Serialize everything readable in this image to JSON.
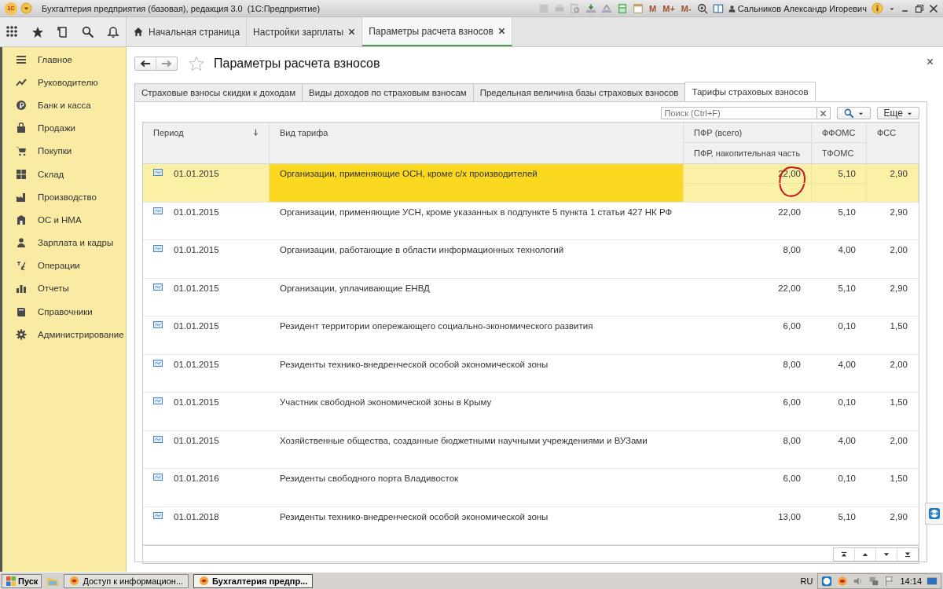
{
  "window": {
    "logo": "1С",
    "title": "Бухгалтерия предприятия (базовая), редакция 3.0  (1С:Предприятие)",
    "memory_buttons": [
      "M",
      "M+",
      "M-"
    ],
    "user": "Сальников Александр Игоревич"
  },
  "section_tabs": [
    {
      "label": "Начальная страница",
      "kind": "home",
      "selected": false
    },
    {
      "label": "Настройки зарплаты",
      "kind": "closable",
      "selected": false
    },
    {
      "label": "Параметры расчета взносов",
      "kind": "closable",
      "selected": true
    }
  ],
  "sidebar": {
    "items": [
      {
        "label": "Главное",
        "kind": "lines"
      },
      {
        "label": "Руководителю",
        "kind": "trend"
      },
      {
        "label": "Банк и касса",
        "kind": "coin"
      },
      {
        "label": "Продажи",
        "kind": "bag"
      },
      {
        "label": "Покупки",
        "kind": "cart"
      },
      {
        "label": "Склад",
        "kind": "grid"
      },
      {
        "label": "Производство",
        "kind": "factory"
      },
      {
        "label": "ОС и НМА",
        "kind": "building"
      },
      {
        "label": "Зарплата и кадры",
        "kind": "person"
      },
      {
        "label": "Операции",
        "kind": "ledger"
      },
      {
        "label": "Отчеты",
        "kind": "bars"
      },
      {
        "label": "Справочники",
        "kind": "book"
      },
      {
        "label": "Администрирование",
        "kind": "gear"
      }
    ]
  },
  "form": {
    "title": "Параметры расчета взносов",
    "tabs": [
      {
        "label": "Страховые взносы скидки к доходам",
        "selected": false
      },
      {
        "label": "Виды доходов по страховым взносам",
        "selected": false
      },
      {
        "label": "Предельная величина базы страховых взносов",
        "selected": false
      },
      {
        "label": "Тарифы страховых взносов",
        "selected": true
      }
    ],
    "search": {
      "placeholder": "Поиск (Ctrl+F)"
    },
    "more_button": "Еще",
    "table": {
      "columns": [
        {
          "label": "Период",
          "sorted": true
        },
        {
          "label": "Вид тарифа"
        },
        {
          "label": "ПФР (всего)",
          "sublabel": "ПФР, накопительная часть"
        },
        {
          "label": "ФФОМС",
          "sublabel": "ТФОМС"
        },
        {
          "label": "ФСС"
        }
      ],
      "rows": [
        {
          "period": "01.01.2015",
          "tariff": "Организации, применяющие ОСН, кроме с/х производителей",
          "pfr": "22,00",
          "ffoms": "5,10",
          "fss": "2,90",
          "selected": true,
          "circled": true
        },
        {
          "period": "01.01.2015",
          "tariff": "Организации, применяющие УСН, кроме указанных в подпункте 5 пункта 1 статьи 427 НК РФ",
          "pfr": "22,00",
          "ffoms": "5,10",
          "fss": "2,90",
          "selected": false,
          "circled": false
        },
        {
          "period": "01.01.2015",
          "tariff": "Организации, работающие в области информационных технологий",
          "pfr": "8,00",
          "ffoms": "4,00",
          "fss": "2,00",
          "selected": false,
          "circled": false
        },
        {
          "period": "01.01.2015",
          "tariff": "Организации, уплачивающие ЕНВД",
          "pfr": "22,00",
          "ffoms": "5,10",
          "fss": "2,90",
          "selected": false,
          "circled": false
        },
        {
          "period": "01.01.2015",
          "tariff": "Резидент территории опережающего социально-экономического развития",
          "pfr": "6,00",
          "ffoms": "0,10",
          "fss": "1,50",
          "selected": false,
          "circled": false
        },
        {
          "period": "01.01.2015",
          "tariff": "Резиденты технико-внедренческой особой экономической зоны",
          "pfr": "8,00",
          "ffoms": "4,00",
          "fss": "2,00",
          "selected": false,
          "circled": false
        },
        {
          "period": "01.01.2015",
          "tariff": "Участник свободной экономической зоны в Крыму",
          "pfr": "6,00",
          "ffoms": "0,10",
          "fss": "1,50",
          "selected": false,
          "circled": false
        },
        {
          "period": "01.01.2015",
          "tariff": "Хозяйственные общества, созданные бюджетными научными учреждениями и ВУЗами",
          "pfr": "8,00",
          "ffoms": "4,00",
          "fss": "2,00",
          "selected": false,
          "circled": false
        },
        {
          "period": "01.01.2016",
          "tariff": "Резиденты свободного порта Владивосток",
          "pfr": "6,00",
          "ffoms": "0,10",
          "fss": "1,50",
          "selected": false,
          "circled": false
        },
        {
          "period": "01.01.2018",
          "tariff": "Резиденты технико-внедренческой особой экономической зоны",
          "pfr": "13,00",
          "ffoms": "5,10",
          "fss": "2,90",
          "selected": false,
          "circled": false
        }
      ]
    }
  },
  "taskbar": {
    "start": "Пуск",
    "tasks": [
      {
        "label": "Доступ к информацион...",
        "selected": false
      },
      {
        "label": "Бухгалтерия предпр...",
        "selected": true
      }
    ],
    "language": "RU",
    "clock": "14:14"
  }
}
